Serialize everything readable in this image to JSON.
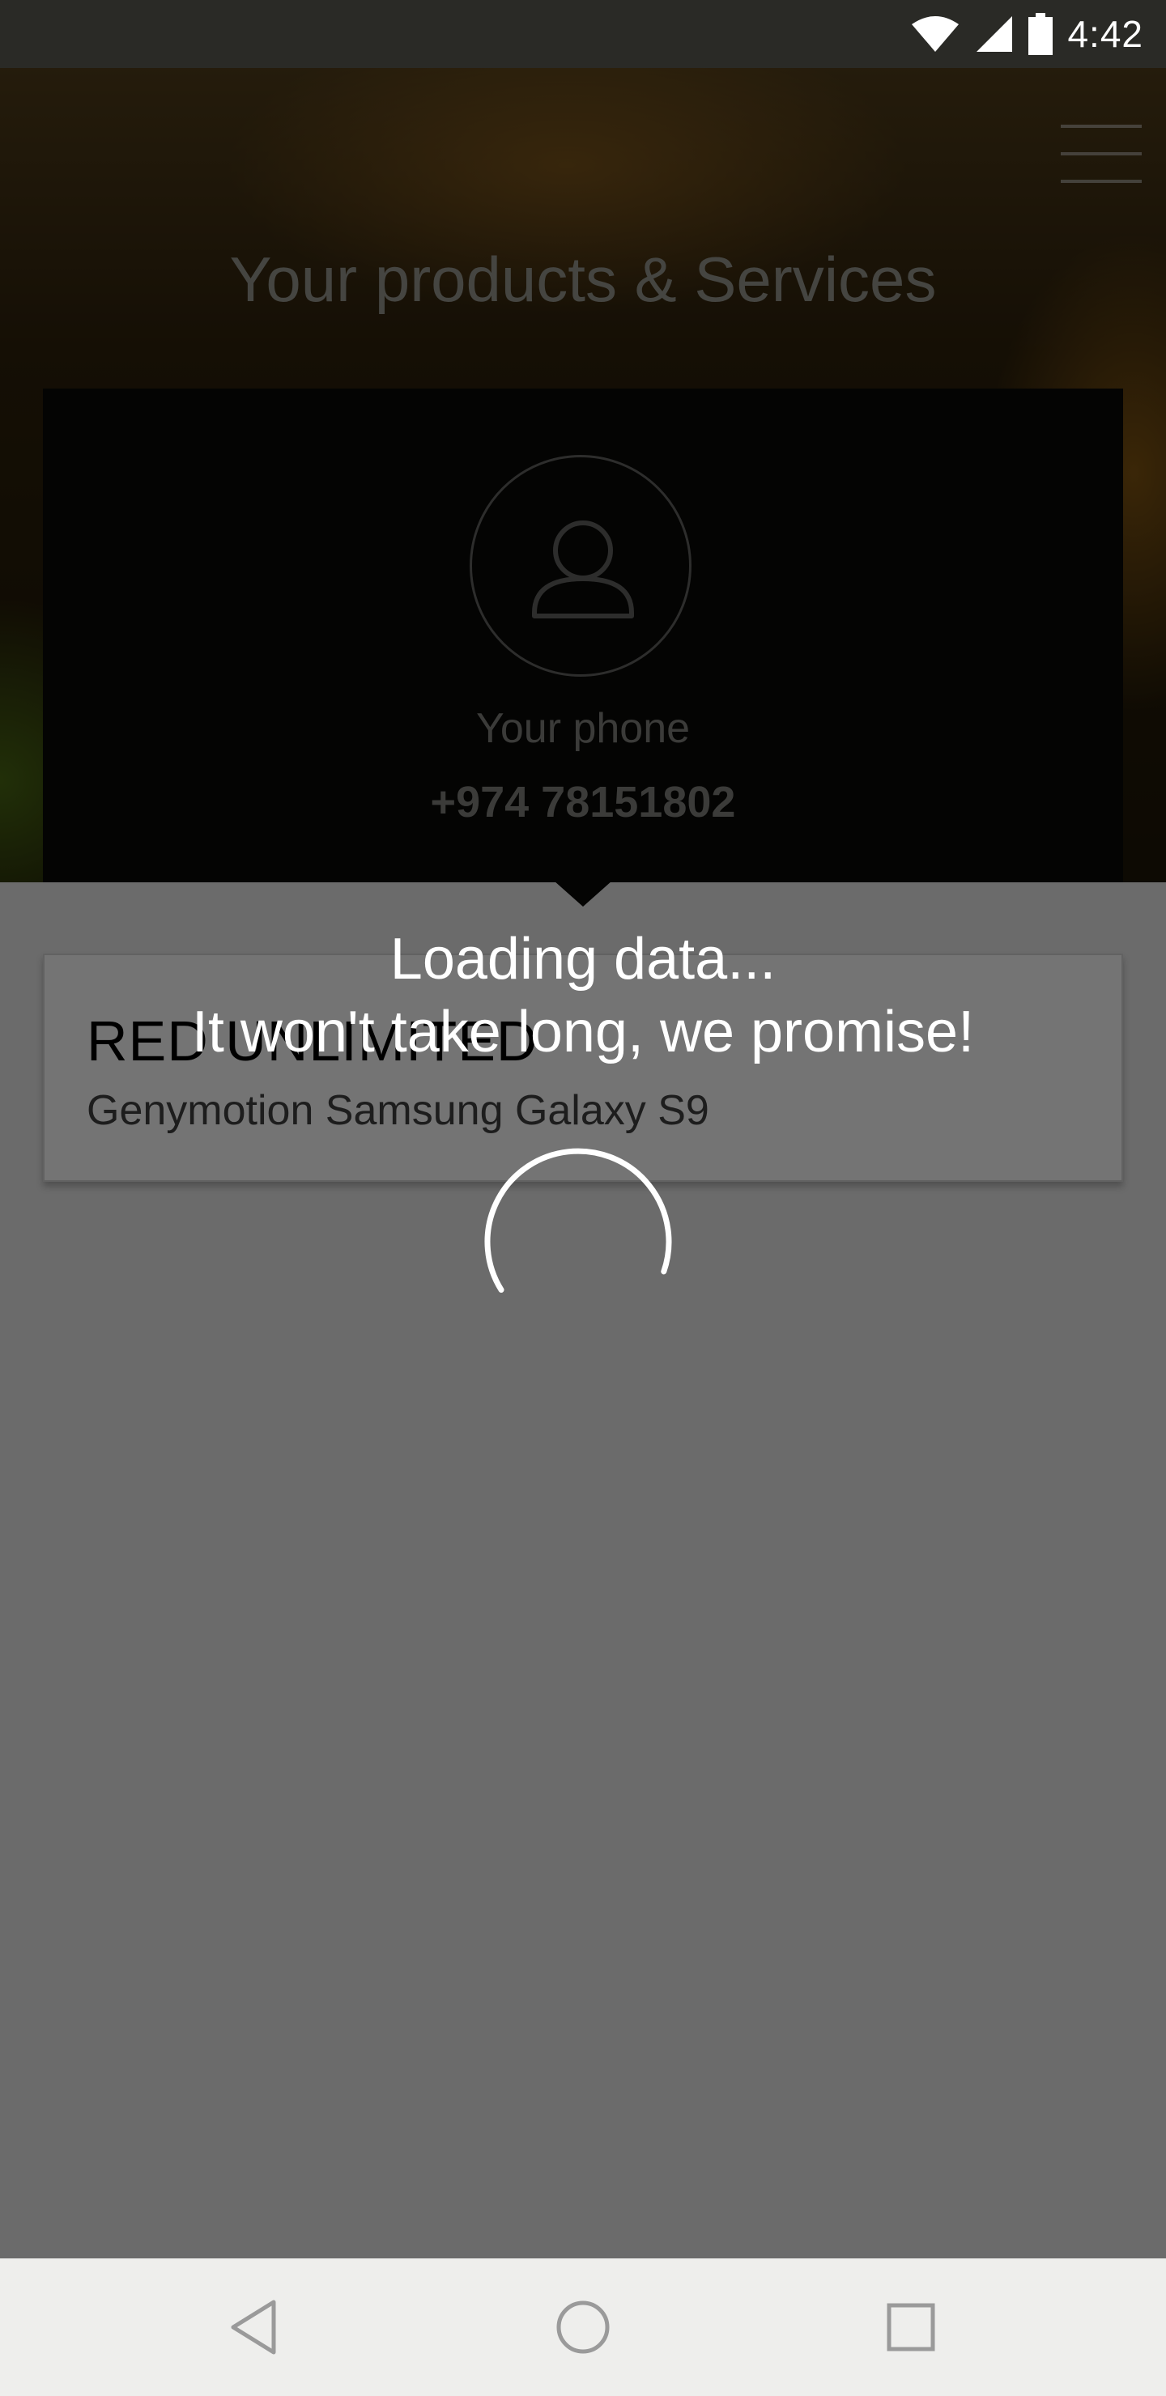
{
  "status_bar": {
    "time": "4:42",
    "icons": [
      "wifi-icon",
      "cell-signal-icon",
      "battery-icon"
    ]
  },
  "header": {
    "menu_icon": "hamburger-menu-icon",
    "title": "Your products & Services"
  },
  "phone_card": {
    "avatar_icon": "user-avatar-icon",
    "label": "Your phone",
    "number": "+974 78151802"
  },
  "plan_card": {
    "name": "RED UNLIMITED",
    "device": "Genymotion Samsung Galaxy S9"
  },
  "loading": {
    "line1": "Loading data...",
    "line2": "It won't take long, we promise!",
    "spinner_icon": "loading-spinner-icon"
  },
  "nav_bar": {
    "back_icon": "back-triangle-icon",
    "home_icon": "home-circle-icon",
    "recent_icon": "recent-apps-square-icon"
  },
  "colors": {
    "overlay": "#808080",
    "status_bar": "#2a2a26",
    "text_white": "#ffffff"
  }
}
